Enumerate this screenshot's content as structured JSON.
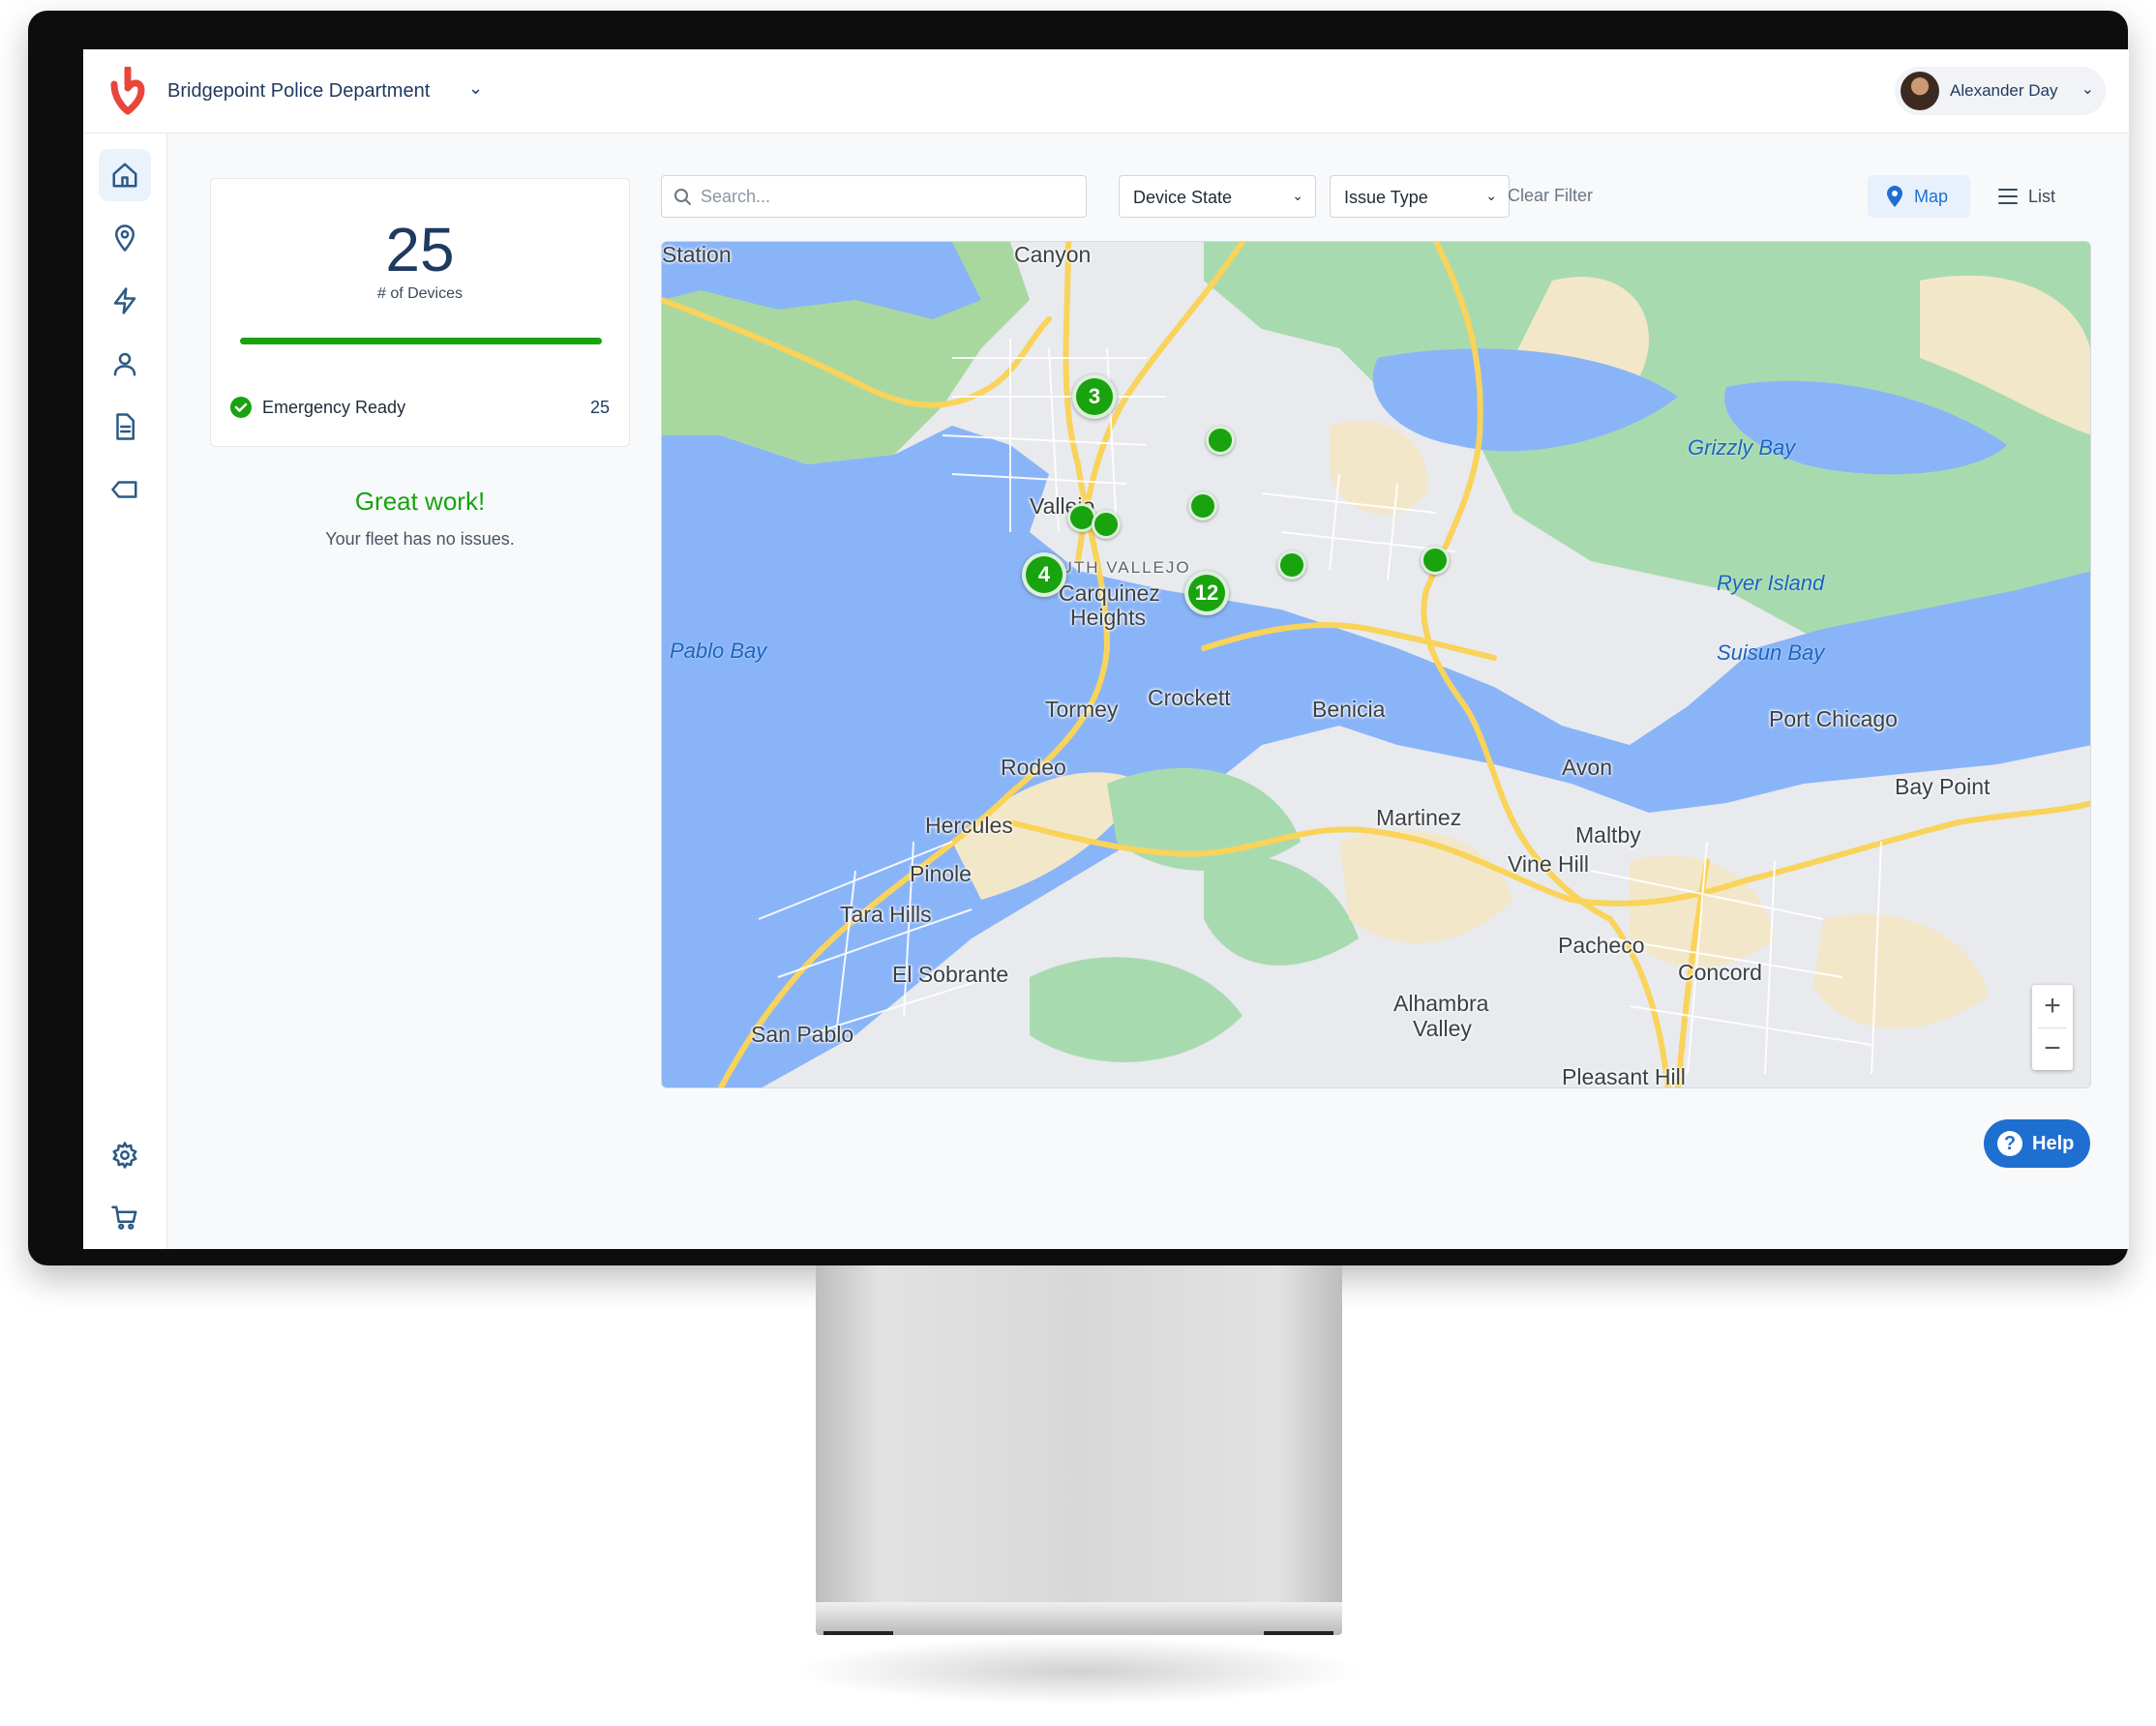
{
  "header": {
    "org_name": "Bridgepoint Police Department",
    "user_name": "Alexander Day"
  },
  "sidebar": {
    "items": [
      {
        "icon": "home-icon",
        "active": true
      },
      {
        "icon": "location-pin-icon",
        "active": false
      },
      {
        "icon": "lightning-icon",
        "active": false
      },
      {
        "icon": "user-icon",
        "active": false
      },
      {
        "icon": "document-icon",
        "active": false
      },
      {
        "icon": "tag-icon",
        "active": false
      }
    ],
    "bottom_items": [
      {
        "icon": "gear-icon"
      },
      {
        "icon": "cart-icon"
      }
    ]
  },
  "stats": {
    "device_count": "25",
    "device_label": "# of Devices",
    "ready_fraction": 1.0,
    "status_label": "Emergency Ready",
    "status_count": "25"
  },
  "message": {
    "title": "Great work!",
    "subtitle": "Your fleet has no issues."
  },
  "toolbar": {
    "search_placeholder": "Search...",
    "device_state_label": "Device State",
    "issue_type_label": "Issue Type",
    "clear_filter_label": "Clear Filter",
    "map_label": "Map",
    "list_label": "List"
  },
  "map": {
    "places": {
      "canyon": "Canyon",
      "vallejo": "Vallejo",
      "south_vallejo": "SOUTH VALLEJO",
      "carquinez": "Carquinez",
      "heights": "Heights",
      "station": "Station",
      "tormey": "Tormey",
      "crockett": "Crockett",
      "benicia": "Benicia",
      "rodeo": "Rodeo",
      "hercules": "Hercules",
      "pinole": "Pinole",
      "tara_hills": "Tara Hills",
      "el_sobrante": "El Sobrante",
      "san_pablo": "San Pablo",
      "martinez": "Martinez",
      "avon": "Avon",
      "maltby": "Maltby",
      "vine_hill": "Vine Hill",
      "pacheco": "Pacheco",
      "concord": "Concord",
      "alhambra": "Alhambra",
      "valley": "Valley",
      "pleasant_hill": "Pleasant Hill",
      "port_chicago": "Port Chicago",
      "bay_point": "Bay Point"
    },
    "water": {
      "grizzly_bay": "Grizzly Bay",
      "ryer_island": "Ryer Island",
      "suisun_bay": "Suisun Bay",
      "pablo_bay": "Pablo Bay"
    },
    "clusters": [
      "3",
      "4",
      "12"
    ],
    "zoom_in": "+",
    "zoom_out": "−"
  },
  "help": {
    "icon": "?",
    "label": "Help"
  },
  "colors": {
    "primary": "#1f6fd1",
    "success": "#18a30f",
    "navy": "#1e3a5f",
    "brand_logo": "#e8453c"
  }
}
